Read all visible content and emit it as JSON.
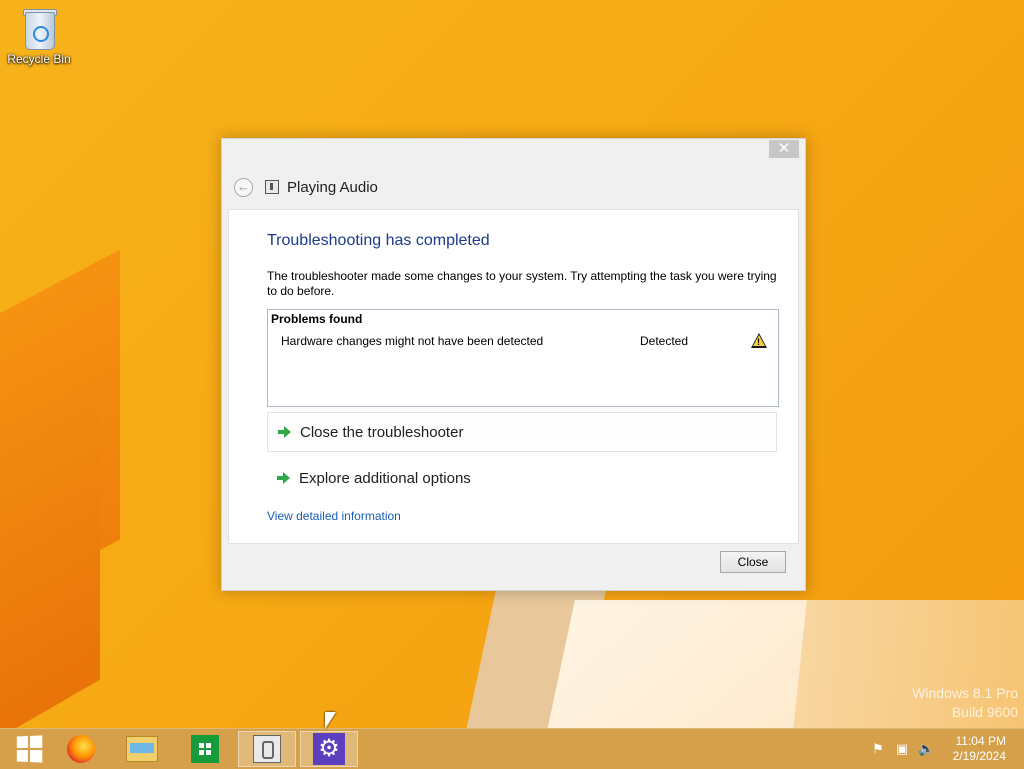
{
  "desktop": {
    "icons": [
      {
        "label": "Recycle Bin",
        "icon": "recycle-bin-icon"
      }
    ],
    "watermark": {
      "line1": "Windows 8.1 Pro",
      "line2": "Build 9600"
    }
  },
  "dialog": {
    "title": "Playing Audio",
    "close_glyph": "✕",
    "back_glyph": "←",
    "headline": "Troubleshooting has completed",
    "description": "The troubleshooter made some changes to your system. Try attempting the task you were trying to do before.",
    "problems": {
      "title": "Problems found",
      "rows": [
        {
          "name": "Hardware changes might not have been detected",
          "status": "Detected",
          "icon": "warning-icon"
        }
      ]
    },
    "actions": [
      {
        "label": "Close the troubleshooter"
      },
      {
        "label": "Explore additional options"
      }
    ],
    "details_link": "View detailed information",
    "close_button": "Close"
  },
  "taskbar": {
    "items": [
      {
        "name": "start-button",
        "icon": "windows-logo-icon"
      },
      {
        "name": "firefox",
        "icon": "firefox-icon"
      },
      {
        "name": "file-explorer",
        "icon": "folder-icon"
      },
      {
        "name": "store",
        "icon": "store-icon"
      },
      {
        "name": "troubleshooter",
        "icon": "troubleshooter-icon",
        "active": true
      },
      {
        "name": "settings",
        "icon": "gear-icon",
        "active": true
      }
    ],
    "tray": {
      "icons": [
        "flag-icon",
        "network-icon",
        "speaker-muted-icon"
      ],
      "time": "11:04 PM",
      "date": "2/19/2024"
    },
    "settings_glyph": "⚙"
  },
  "colors": {
    "headline": "#1c3a8b",
    "link": "#1a5fb4",
    "action_arrow": "#2ea84a",
    "settings_tile": "#5b3fbf"
  }
}
